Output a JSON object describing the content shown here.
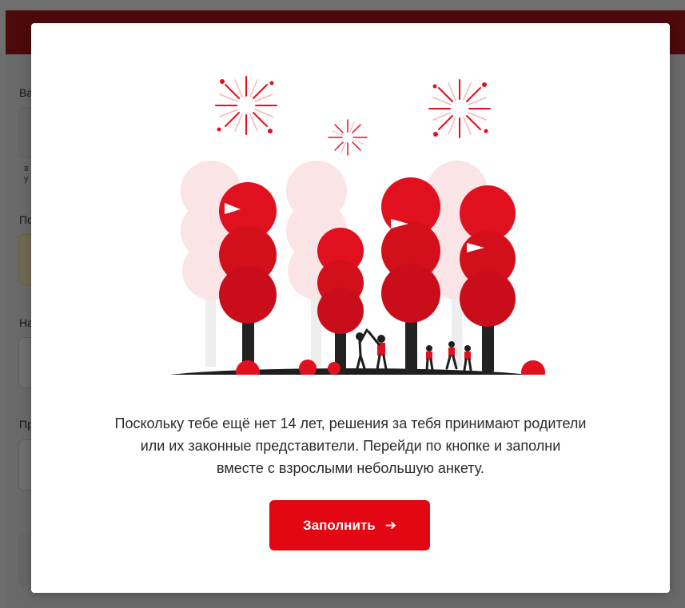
{
  "background": {
    "labels": [
      "Ва",
      "По",
      "На",
      "Пр"
    ],
    "hint_lines": [
      "в",
      "у"
    ]
  },
  "modal": {
    "message_lines": [
      "Поскольку тебе ещё нет 14 лет, решения за тебя принимают родители",
      "или их законные представители. Перейди по кнопке и заполни",
      "вместе с взрослыми небольшую анкету."
    ],
    "cta_label": "Заполнить",
    "cta_icon": "arrow-right-icon",
    "illustration": "celebration-park-illustration"
  },
  "colors": {
    "accent": "#e30613",
    "header": "#b4151b",
    "tree_red": "#e0101e",
    "tree_pale": "#fbe4e6",
    "ground": "#1e1e1e"
  }
}
